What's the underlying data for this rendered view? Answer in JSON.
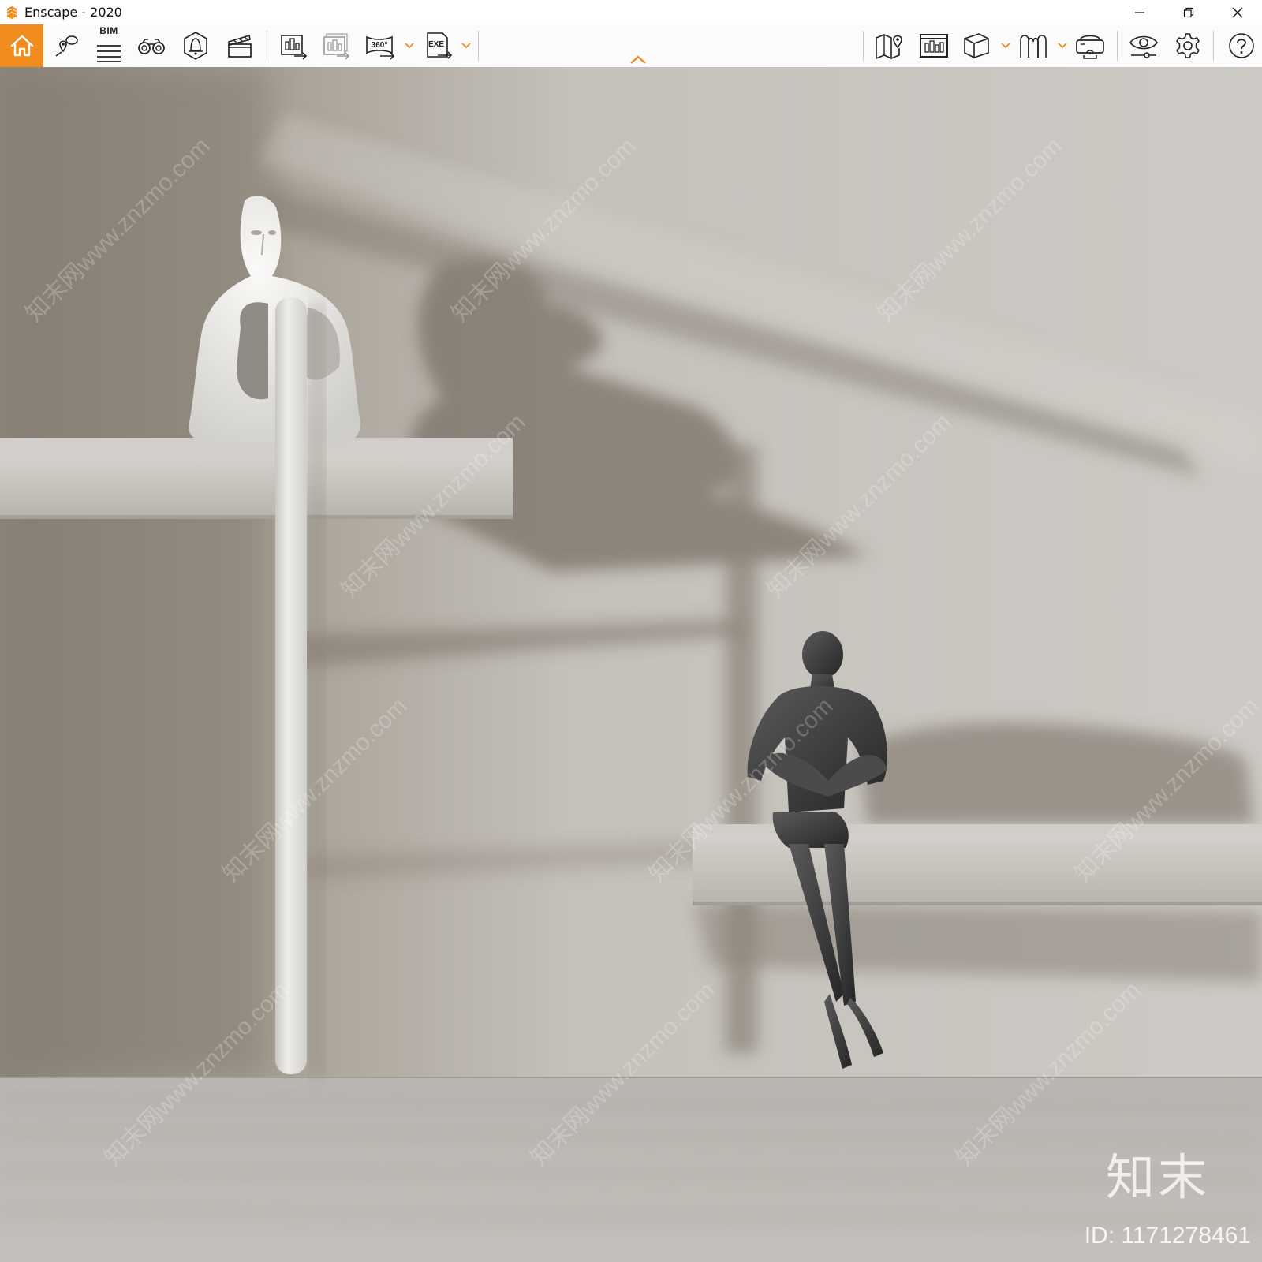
{
  "window": {
    "title": "Enscape - 2020",
    "accent_color": "#f08c1e",
    "controls": [
      "minimize-icon",
      "restore-icon",
      "close-icon"
    ]
  },
  "toolbar": {
    "bim_label": "BIM",
    "left_tools": [
      "home-icon",
      "views-icon",
      "bim-icon",
      "binoculars-icon",
      "atmosphere-icon",
      "video-editor-icon"
    ],
    "export_tools": [
      "render-export-icon",
      "batch-render-icon",
      "panorama-360-icon",
      "exe-export-icon"
    ],
    "panorama_label": "360°",
    "exe_label": "EXE",
    "right_tools": [
      "map-icon",
      "asset-library-icon",
      "orthographic-icon",
      "vr-headset-icon",
      "vr-mode-icon",
      "visual-settings-icon",
      "settings-icon",
      "help-icon"
    ],
    "collapse_icon": "chevron-up-icon"
  },
  "viewport": {
    "scene": "Two sculptures on wall shelves: white abstract bust and dark seated reading figure",
    "watermark_domain": "知末网www.znzmo.com",
    "watermark_brand": "知末",
    "watermark_id": "ID: 1171278461",
    "colors": {
      "wall": "#c9c6c1",
      "floor": "#bdbab5",
      "shadow": "#6e6760",
      "shelf": "#c4c1bc",
      "white_sculpture": "#e8e6e3",
      "dark_sculpture": "#3a3a3a"
    }
  }
}
